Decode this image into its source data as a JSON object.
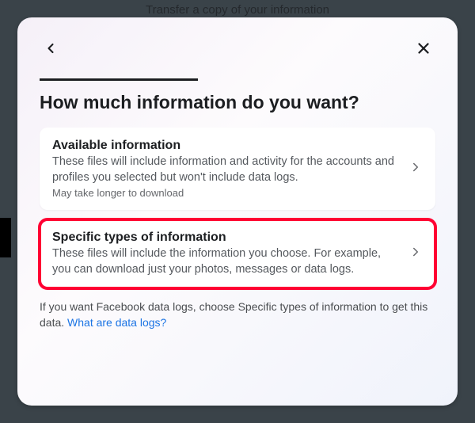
{
  "backdrop": {
    "title": "Transfer a copy of your information"
  },
  "modal": {
    "title": "How much information do you want?"
  },
  "options": [
    {
      "title": "Available information",
      "description": "These files will include information and activity for the accounts and profiles you selected but won't include data logs.",
      "note": "May take longer to download"
    },
    {
      "title": "Specific types of information",
      "description": "These files will include the information you choose. For example, you can download just your photos, messages or data logs."
    }
  ],
  "footer": {
    "text": "If you want Facebook data logs, choose Specific types of information to get this data. ",
    "link": "What are data logs?"
  }
}
